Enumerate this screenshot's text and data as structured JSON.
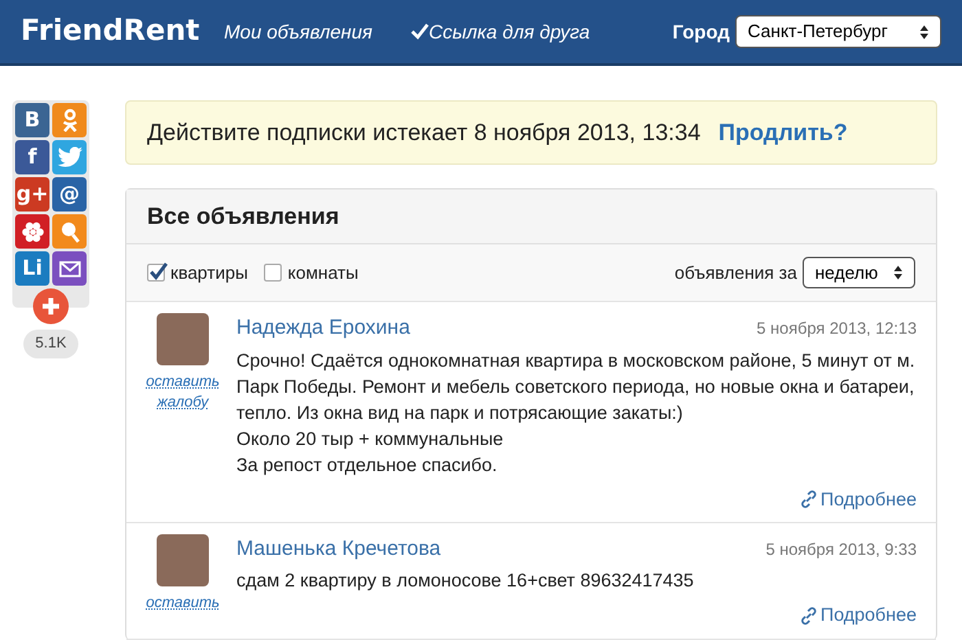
{
  "header": {
    "logo": "FriendRent",
    "nav": [
      {
        "label": "Мои объявления",
        "check": false
      },
      {
        "label": "Ссылка для друга",
        "check": true
      }
    ],
    "city_label": "Город",
    "city": "Санкт-Петербург"
  },
  "share": {
    "buttons": [
      {
        "kind": "text",
        "label": "B",
        "color": "#3b6593"
      },
      {
        "kind": "ok",
        "color": "#f08a1c"
      },
      {
        "kind": "text",
        "label": "f",
        "color": "#3b5998"
      },
      {
        "kind": "bird",
        "color": "#2fa6e0"
      },
      {
        "kind": "text",
        "label": "g+",
        "color": "#cc3a22"
      },
      {
        "kind": "text",
        "label": "@",
        "color": "#2a64a6"
      },
      {
        "kind": "flower",
        "color": "#d11f25"
      },
      {
        "kind": "search",
        "color": "#f28a1c"
      },
      {
        "kind": "text",
        "label": "Li",
        "color": "#1b7cc0"
      },
      {
        "kind": "envelope",
        "color": "#7b4fbf"
      }
    ],
    "count": "5.1K"
  },
  "notice": {
    "text": "Действите подписки истекает 8 ноября 2013, 13:34",
    "link": "Продлить?"
  },
  "listing": {
    "title": "Все объявления",
    "filters": [
      {
        "label": "квартиры",
        "checked": true
      },
      {
        "label": "комнаты",
        "checked": false
      }
    ],
    "period_label": "объявления за",
    "period": "неделю",
    "posts": [
      {
        "author": "Надежда Ерохина",
        "date": "5 ноября 2013, 12:13",
        "complaint": "оставить жалобу",
        "lines": [
          "Срочно! Сдаётся однокомнатная квартира в московском районе, 5 минут от м. Парк Победы. Ремонт и мебель советского периода, но новые окна и батареи, тепло. Из окна вид на парк и потрясающие закаты:)",
          "Около 20 тыр + коммунальные",
          "За репост отдельное спасибо."
        ],
        "more": "Подробнее"
      },
      {
        "author": "Машенька Кречетова",
        "date": "5 ноября 2013, 9:33",
        "complaint": "оставить",
        "lines": [
          "сдам 2 квартиру в ломоносове 16+свет 89632417435"
        ],
        "more": "Подробнее"
      }
    ]
  }
}
